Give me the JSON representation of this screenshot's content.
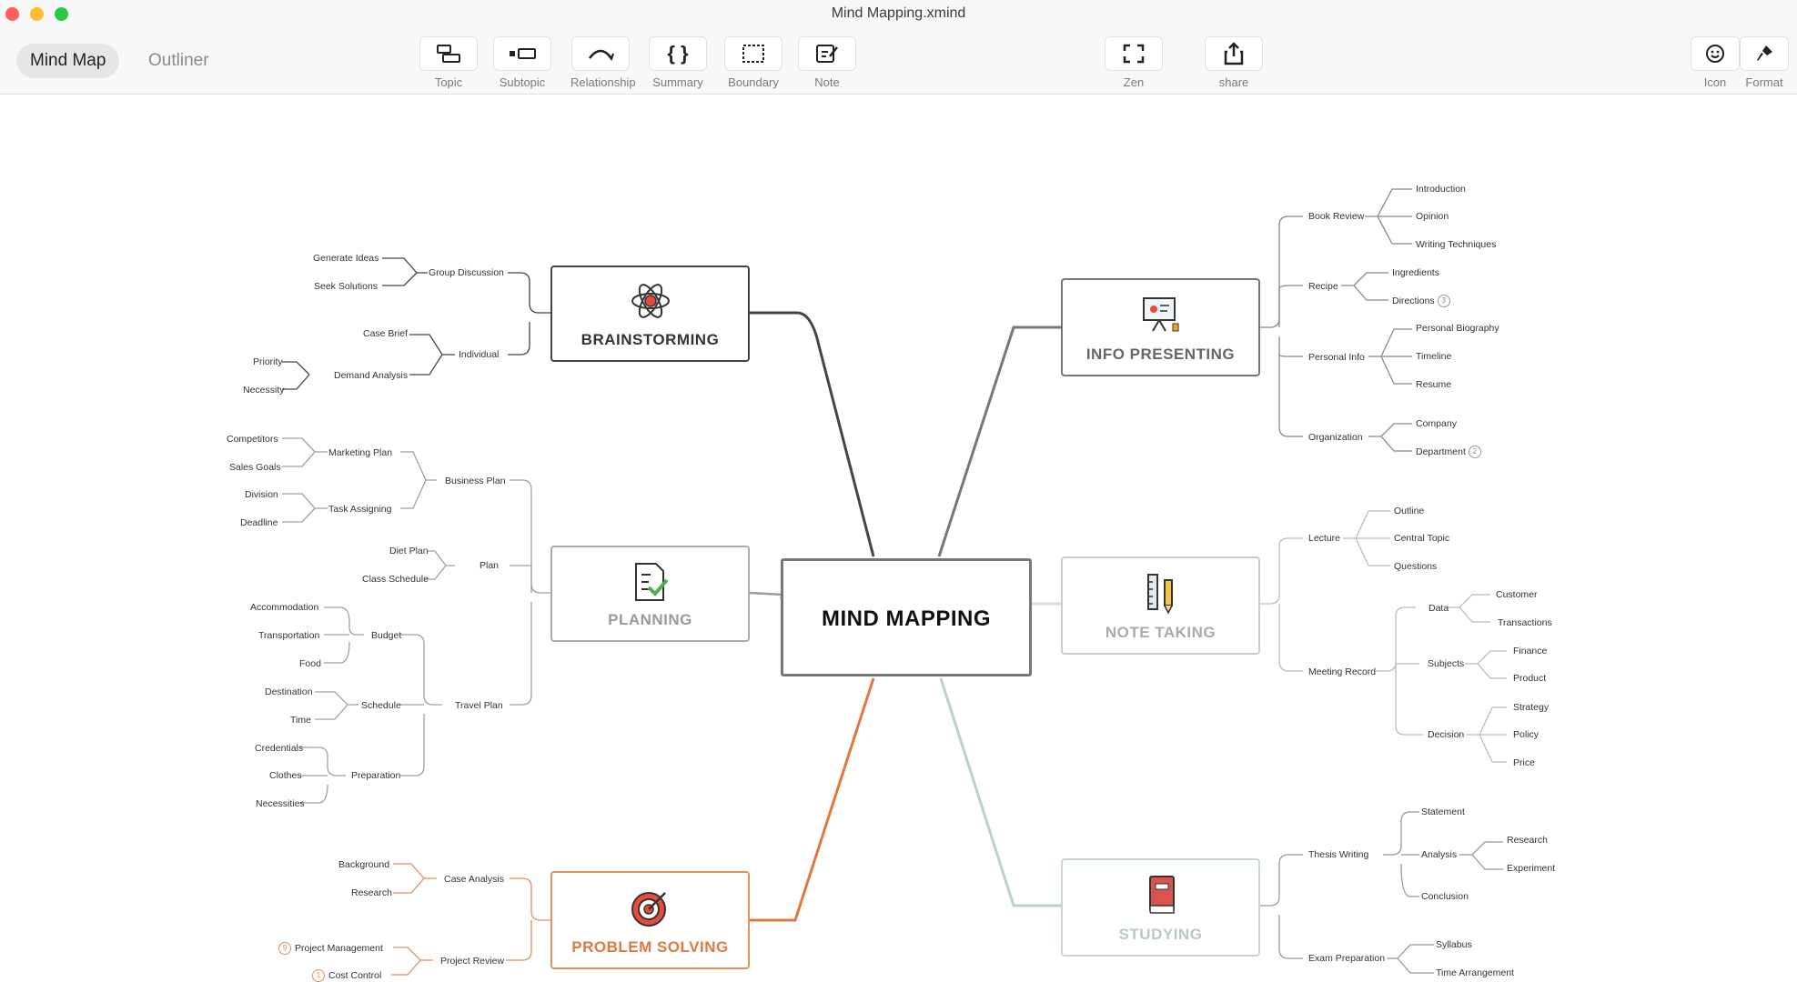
{
  "window": {
    "title": "Mind Mapping.xmind"
  },
  "view_tabs": [
    {
      "label": "Mind Map"
    },
    {
      "label": "Outliner"
    }
  ],
  "toolbar": {
    "topic": "Topic",
    "subtopic": "Subtopic",
    "relationship": "Relationship",
    "summary": "Summary",
    "boundary": "Boundary",
    "note": "Note",
    "zen": "Zen",
    "share": "share",
    "icon": "Icon",
    "format": "Format"
  },
  "colors": {
    "dark": "#444444",
    "gray": "#9a9a9a",
    "orange": "#e0783f",
    "teal": "#bccfcf",
    "studying_red": "#d9534f"
  },
  "central": {
    "label": "MIND MAPPING"
  },
  "topics": {
    "brainstorming": {
      "label": "BRAINSTORMING",
      "icon": "atom-icon",
      "children": [
        {
          "label": "Group Discussion",
          "children": [
            "Generate Ideas",
            "Seek Solutions"
          ]
        },
        {
          "label": "Individual",
          "children": [
            {
              "label": "Case Brief"
            },
            {
              "label": "Demand Analysis",
              "children": [
                "Priority",
                "Necessity"
              ]
            }
          ]
        }
      ]
    },
    "planning": {
      "label": "PLANNING",
      "icon": "checklist-icon",
      "children": [
        {
          "label": "Business Plan",
          "children": [
            {
              "label": "Marketing Plan",
              "children": [
                "Competitors",
                "Sales Goals"
              ]
            },
            {
              "label": "Task Assigning",
              "children": [
                "Division",
                "Deadline"
              ]
            }
          ]
        },
        {
          "label": "Plan",
          "children": [
            "Diet Plan",
            "Class Schedule"
          ]
        },
        {
          "label": "Travel Plan",
          "children": [
            {
              "label": "Budget",
              "children": [
                "Accommodation",
                "Transportation",
                "Food"
              ]
            },
            {
              "label": "Schedule",
              "children": [
                "Destination",
                "Time"
              ]
            },
            {
              "label": "Preparation",
              "children": [
                "Credentials",
                "Clothes",
                "Necessities"
              ]
            }
          ]
        }
      ]
    },
    "problem_solving": {
      "label": "PROBLEM SOLVING",
      "icon": "target-icon",
      "children": [
        {
          "label": "Case Analysis",
          "children": [
            "Background",
            "Research"
          ]
        },
        {
          "label": "Project Review",
          "children": [
            {
              "label": "Project Management",
              "badge": "9"
            },
            {
              "label": "Cost Control",
              "badge": "1"
            }
          ]
        }
      ]
    },
    "info_presenting": {
      "label": "INFO PRESENTING",
      "icon": "presentation-icon",
      "children": [
        {
          "label": "Book Review",
          "children": [
            "Introduction",
            "Opinion",
            "Writing Techniques"
          ]
        },
        {
          "label": "Recipe",
          "children": [
            {
              "label": "Ingredients"
            },
            {
              "label": "Directions",
              "badge": "3"
            }
          ]
        },
        {
          "label": "Personal Info",
          "children": [
            "Personal Biography",
            "Timeline",
            "Resume"
          ]
        },
        {
          "label": "Organization",
          "children": [
            {
              "label": "Company"
            },
            {
              "label": "Department",
              "badge": "2"
            }
          ]
        }
      ]
    },
    "note_taking": {
      "label": "NOTE TAKING",
      "icon": "ruler-pencil-icon",
      "children": [
        {
          "label": "Lecture",
          "children": [
            "Outline",
            "Central Topic",
            "Questions"
          ]
        },
        {
          "label": "Meeting Record",
          "children": [
            {
              "label": "Data",
              "children": [
                "Customer",
                "Transactions"
              ]
            },
            {
              "label": "Subjects",
              "children": [
                "Finance",
                "Product"
              ]
            },
            {
              "label": "Decision",
              "children": [
                "Strategy",
                "Policy",
                "Price"
              ]
            }
          ]
        }
      ]
    },
    "studying": {
      "label": "STUDYING",
      "icon": "book-icon",
      "children": [
        {
          "label": "Thesis Writing",
          "children": [
            {
              "label": "Statement"
            },
            {
              "label": "Analysis",
              "children": [
                "Research",
                "Experiment"
              ]
            },
            {
              "label": "Conclusion"
            }
          ]
        },
        {
          "label": "Exam Preparation",
          "children": [
            "Syllabus",
            "Time Arrangement"
          ]
        }
      ]
    }
  }
}
